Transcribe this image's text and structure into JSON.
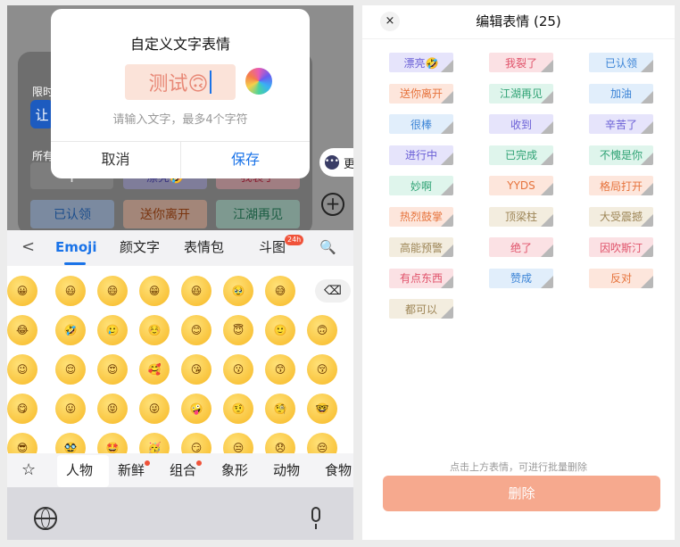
{
  "background": {
    "limited_label": "限时",
    "blue_tile": "让",
    "all_label": "所有",
    "plus": "+",
    "peek_tags": [
      "漂亮🤣",
      "我裂了"
    ],
    "row2_tags": [
      "已认领",
      "送你离开",
      "江湖再见"
    ],
    "more_label": "更",
    "more_icon": "•••",
    "plus_circle": "+"
  },
  "dialog": {
    "title": "自定义文字表情",
    "preview_text": "测试🙃",
    "hint": "请输入文字，最多4个字符",
    "cancel": "取消",
    "save": "保存"
  },
  "keyboard": {
    "tabs": [
      "<",
      "Emoji",
      "颜文字",
      "表情包",
      "斗图",
      "🔍"
    ],
    "badge": "24h",
    "emoji_rows": [
      [
        "😀",
        "😃",
        "😄",
        "😁",
        "😆",
        "🥹",
        "😅"
      ],
      [
        "😂",
        "🤣",
        "🥲",
        "☺️",
        "😊",
        "😇",
        "🙂",
        "🙃"
      ],
      [
        "😉",
        "😌",
        "😍",
        "🥰",
        "😘",
        "😗",
        "😙",
        "😚"
      ],
      [
        "😋",
        "😛",
        "😝",
        "😜",
        "🤪",
        "🤨",
        "🧐",
        "🤓"
      ],
      [
        "😎",
        "🥸",
        "🤩",
        "🥳",
        "😏",
        "😒",
        "😞",
        "😔"
      ]
    ],
    "backspace": "⌫",
    "categories": [
      "☆",
      "人物",
      "新鲜",
      "组合",
      "象形",
      "动物",
      "食物"
    ]
  },
  "editor": {
    "close": "×",
    "title": "编辑表情 (25)",
    "tags": [
      "漂亮🤣",
      "我裂了",
      "已认领",
      "送你离开",
      "江湖再见",
      "加油",
      "很棒",
      "收到",
      "辛苦了",
      "进行中",
      "已完成",
      "不愧是你",
      "妙啊",
      "YYDS",
      "格局打开",
      "热烈鼓掌",
      "顶梁柱",
      "大受震撼",
      "高能预警",
      "绝了",
      "因吹斯汀",
      "有点东西",
      "赞成",
      "反对",
      "都可以"
    ],
    "hint": "点击上方表情，可进行批量删除",
    "delete": "删除"
  },
  "colors": {
    "accent": "#1a73e8",
    "delete_button": "#f6a98e",
    "tag_palette": [
      {
        "bg": "#e6e4fb",
        "fg": "#6a5fd6"
      },
      {
        "bg": "#fbe1e4",
        "fg": "#e0526a"
      },
      {
        "bg": "#e1eefb",
        "fg": "#3a83d6"
      },
      {
        "bg": "#fde6dc",
        "fg": "#e6733c"
      },
      {
        "bg": "#dff5ec",
        "fg": "#2fa274"
      },
      {
        "bg": "#f3eddf",
        "fg": "#9d8556"
      }
    ]
  }
}
